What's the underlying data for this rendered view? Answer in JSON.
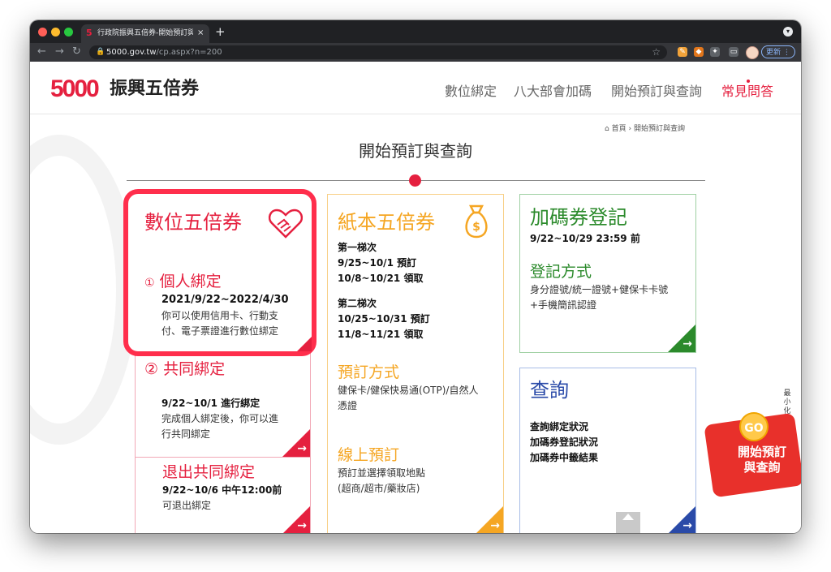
{
  "browser": {
    "tab_title": "行政院振興五倍券-開始預訂與查",
    "tab_close": "×",
    "new_tab": "+",
    "url_host": "5000.gov.tw",
    "url_path": "/cp.aspx?n=200",
    "update_label": "更新",
    "favicon": "5"
  },
  "header": {
    "logo_number": "5000",
    "logo_text": "振興五倍券",
    "nav": [
      "數位綁定",
      "八大部會加碼",
      "開始預訂與查詢",
      "常見問答"
    ]
  },
  "breadcrumb": {
    "home": "首頁",
    "separator": "›",
    "current": "開始預訂與查詢"
  },
  "page_title": "開始預訂與查詢",
  "digital": {
    "title": "數位五倍券",
    "personal": {
      "num": "①",
      "title": "個人綁定",
      "date": "2021/9/22~2022/4/30",
      "desc1": "你可以使用信用卡、行動支",
      "desc2": "付、電子票證進行數位綁定"
    },
    "joint": {
      "num": "②",
      "title": "共同綁定",
      "date": "9/22~10/1 進行綁定",
      "desc1": "完成個人綁定後，你可以進",
      "desc2": "行共同綁定"
    },
    "exit": {
      "title": "退出共同綁定",
      "date": "9/22~10/6 中午12:00前",
      "desc": "可退出綁定"
    }
  },
  "paper": {
    "title": "紙本五倍券",
    "batch1_label": "第一梯次",
    "batch1_order": "9/25~10/1 預訂",
    "batch1_pickup": "10/8~10/21 領取",
    "batch2_label": "第二梯次",
    "batch2_order": "10/25~10/31 預訂",
    "batch2_pickup": "11/8~11/21 領取",
    "method_title": "預訂方式",
    "method_desc1": "健保卡/健保快易通(OTP)/自然人",
    "method_desc2": "憑證",
    "online_title": "線上預訂",
    "online_desc1": "預訂並選擇領取地點",
    "online_desc2": "(超商/超市/藥妝店)"
  },
  "bonus": {
    "title": "加碼券登記",
    "date": "9/22~10/29 23:59 前",
    "method_title": "登記方式",
    "desc1": "身分證號/統一證號+健保卡卡號",
    "desc2": "+手機簡訊認證"
  },
  "query": {
    "title": "查詢",
    "item1": "查詢綁定狀況",
    "item2": "加碼券登記狀況",
    "item3": "加碼券中籤結果"
  },
  "sidebar": {
    "minimize": "最小化"
  },
  "promo": {
    "coin": "GO",
    "line1": "開始預訂",
    "line2": "與查詢"
  },
  "arrow": "→",
  "colors": {
    "brand_red": "#e5203f",
    "orange": "#f5a623",
    "green": "#2b8a2b",
    "blue": "#2a4aa8"
  }
}
